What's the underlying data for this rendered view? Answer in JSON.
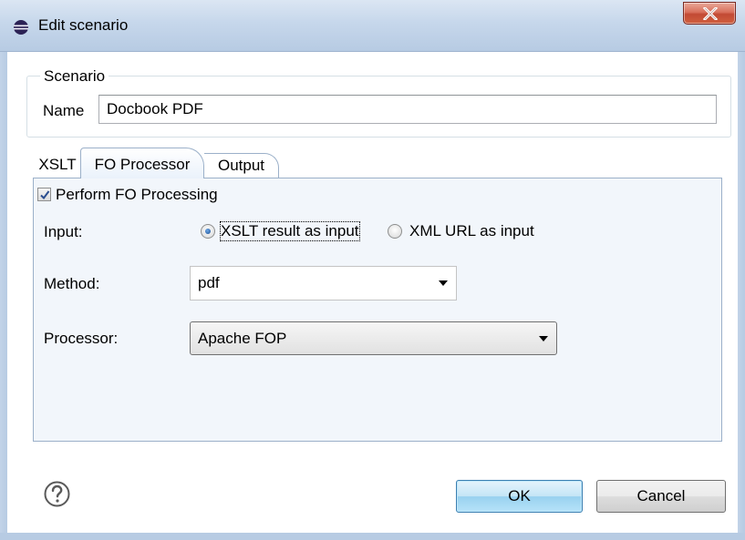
{
  "window": {
    "title": "Edit scenario",
    "close_label": "X"
  },
  "scenario": {
    "group_label": "Scenario",
    "name_label": "Name",
    "name_value": "Docbook PDF"
  },
  "tabs": [
    {
      "label": "XSLT",
      "selected": false
    },
    {
      "label": "FO Processor",
      "selected": true
    },
    {
      "label": "Output",
      "selected": false
    }
  ],
  "fo_panel": {
    "perform_label": "Perform FO Processing",
    "perform_checked": true,
    "input_label": "Input:",
    "input_options": [
      {
        "label": "XSLT result as input",
        "checked": true
      },
      {
        "label": "XML URL as input",
        "checked": false
      }
    ],
    "method_label": "Method:",
    "method_value": "pdf",
    "processor_label": "Processor:",
    "processor_value": "Apache FOP"
  },
  "footer": {
    "ok_label": "OK",
    "cancel_label": "Cancel"
  },
  "icons": {
    "app": "eclipse-icon",
    "help": "question-mark-icon",
    "close": "close-icon"
  }
}
